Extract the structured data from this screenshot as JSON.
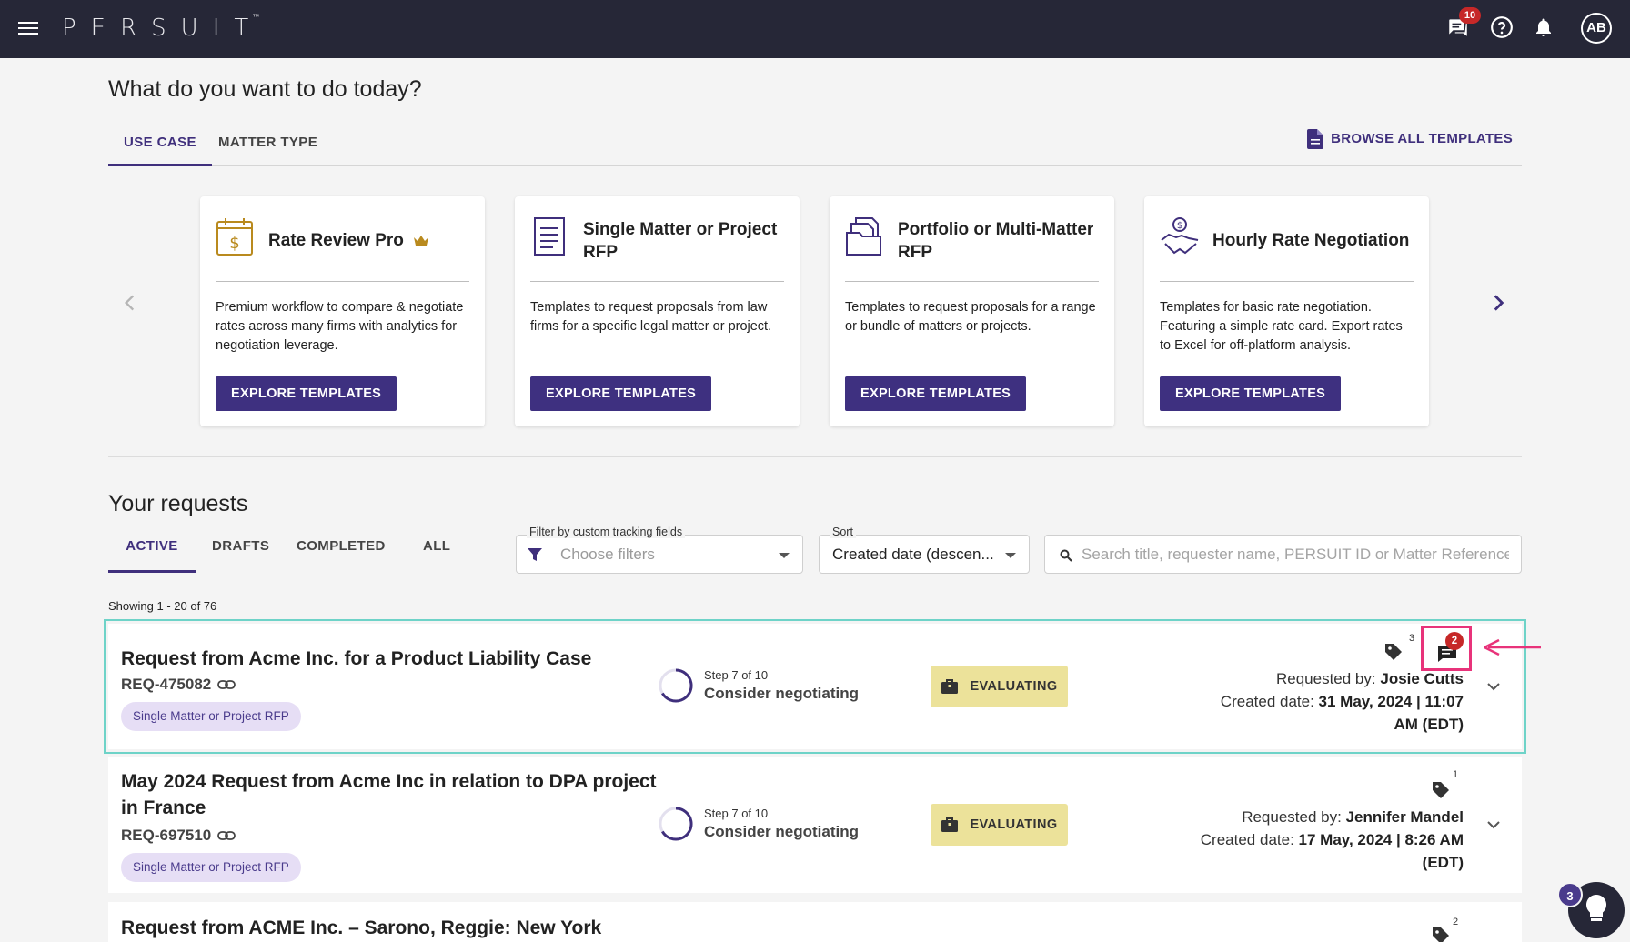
{
  "header": {
    "logo": "PERSUIT",
    "logo_tm": "™",
    "messages_badge": "10",
    "avatar_initials": "AB"
  },
  "page": {
    "title": "What do you want to do today?",
    "tabs": [
      {
        "label": "USE CASE"
      },
      {
        "label": "MATTER TYPE"
      }
    ],
    "browse_all": "BROWSE ALL TEMPLATES"
  },
  "cards": [
    {
      "title": "Rate Review Pro",
      "desc": "Premium workflow to compare & negotiate rates across many firms with analytics for negotiation leverage.",
      "button": "EXPLORE TEMPLATES"
    },
    {
      "title": "Single Matter or Project RFP",
      "desc": "Templates to request proposals from law firms for a specific legal matter or project.",
      "button": "EXPLORE TEMPLATES"
    },
    {
      "title": "Portfolio or Multi-Matter RFP",
      "desc": "Templates to request proposals for a range or bundle of matters or projects.",
      "button": "EXPLORE TEMPLATES"
    },
    {
      "title": "Hourly Rate Negotiation",
      "desc": "Templates for basic rate negotiation. Featuring a simple rate card. Export rates to Excel for off-platform analysis.",
      "button": "EXPLORE TEMPLATES"
    }
  ],
  "requests": {
    "title": "Your requests",
    "tabs": [
      {
        "label": "ACTIVE"
      },
      {
        "label": "DRAFTS"
      },
      {
        "label": "COMPLETED"
      },
      {
        "label": "ALL"
      }
    ],
    "filter_label": "Filter by custom tracking fields",
    "filter_placeholder": "Choose filters",
    "sort_label": "Sort",
    "sort_value": "Created date (descen...",
    "search_placeholder": "Search title, requester name, PERSUIT ID or Matter Reference",
    "showing": "Showing 1 - 20 of 76",
    "rows": [
      {
        "title": "Request from Acme Inc. for a Product Liability Case",
        "id": "REQ-475082",
        "type": "Single Matter or Project RFP",
        "step_small": "Step 7 of 10",
        "step_label": "Consider negotiating",
        "status": "EVALUATING",
        "requested_by_label": "Requested by:",
        "requested_by": "Josie Cutts",
        "created_label": "Created date:",
        "created_line1": "31 May, 2024 | 11:07",
        "created_line2": "AM (EDT)",
        "tag_count": "3",
        "message_count": "2"
      },
      {
        "title": "May 2024 Request from Acme Inc in relation to DPA project in France",
        "id": "REQ-697510",
        "type": "Single Matter or Project RFP",
        "step_small": "Step 7 of 10",
        "step_label": "Consider negotiating",
        "status": "EVALUATING",
        "requested_by_label": "Requested by:",
        "requested_by": "Jennifer Mandel",
        "created_label": "Created date:",
        "created_line1": "17 May, 2024 | 8:26 AM",
        "created_line2": "(EDT)",
        "tag_count": "1"
      },
      {
        "title": "Request from ACME Inc. – Sarono, Reggie: New York",
        "tag_count": "2"
      }
    ]
  },
  "help": {
    "badge": "3"
  },
  "colors": {
    "primary": "#3e3080",
    "status_evaluating": "#ece29a",
    "highlight": "#6ed3c8",
    "annotation": "#e8337a"
  }
}
